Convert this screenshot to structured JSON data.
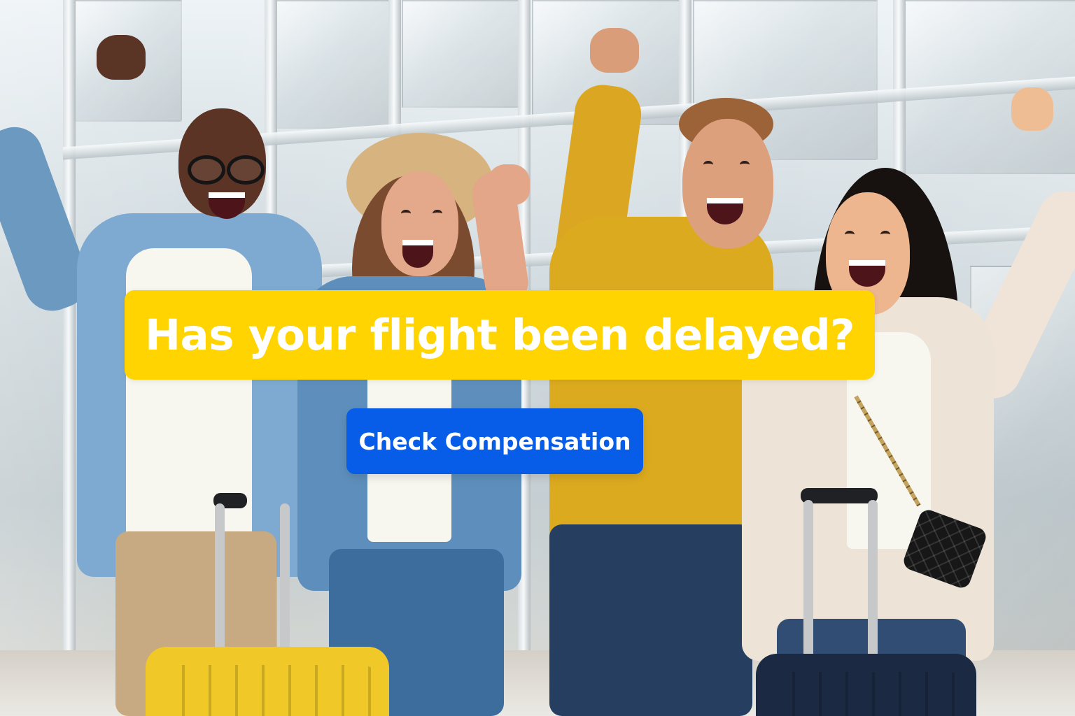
{
  "hero": {
    "headline": "Has your flight been delayed?",
    "cta_label": "Check Compensation"
  },
  "colors": {
    "headline_background": "#ffd400",
    "cta_background": "#075de8",
    "text": "#ffffff"
  },
  "image": {
    "scene": "airport-travelers-celebrating",
    "people_count": 4,
    "luggage": [
      "yellow-suitcase",
      "navy-suitcase"
    ]
  }
}
